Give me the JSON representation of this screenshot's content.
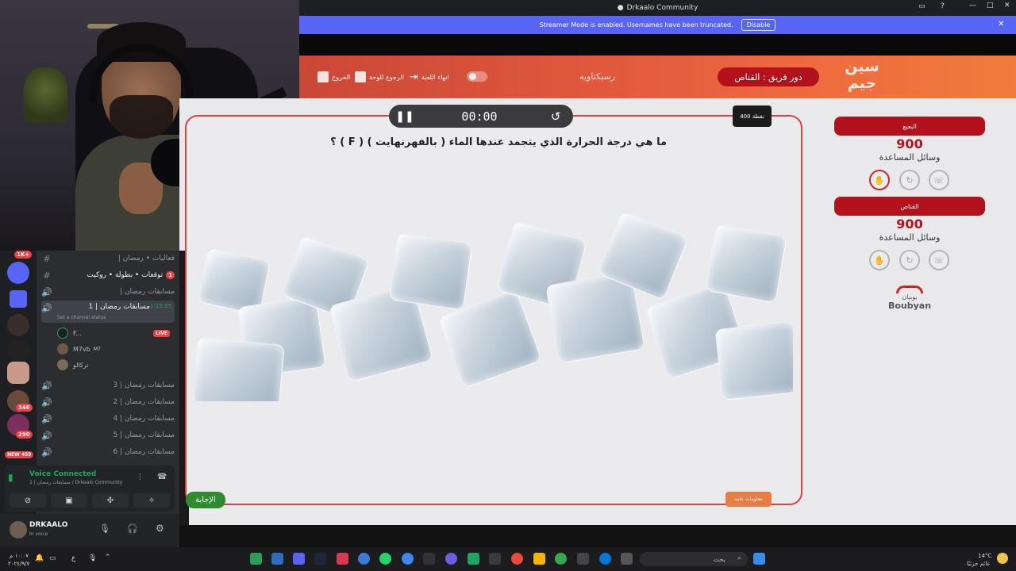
{
  "window": {
    "title": "Drkaalo Community",
    "streamer_banner": "Streamer Mode is enabled. Usernames have been truncated.",
    "disable_label": "Disable"
  },
  "game": {
    "header": {
      "exit": "الخروج",
      "back_to_board": "الرجوع للوحة",
      "end_game": "انهاء اللعبة",
      "game_name": "رسبكتاويه",
      "turn": "دور فريق : القناص",
      "logo": "سين جيم"
    },
    "timer": "00:00",
    "points_badge": "400 نقطة",
    "question": "ما هي درجة الحرارة الذي يتجمد عندها الماء ( بالفهرنهايت ) ( F ) ؟",
    "answer_button": "الإجابة",
    "info_button": "معلومات عامة",
    "teams": [
      {
        "name": "البعبع",
        "score": "900",
        "aids_label": "وسائل المساعدة"
      },
      {
        "name": "القناص",
        "score": "900",
        "aids_label": "وسائل المساعدة"
      }
    ],
    "sponsor": {
      "arabic": "بوبيان",
      "english": "Boubyan"
    }
  },
  "discord": {
    "server_badges": [
      "1K+",
      "1",
      "346",
      "290",
      "NEW 459"
    ],
    "channels": [
      {
        "name": "فعاليات • رمضان |",
        "icon": "#"
      },
      {
        "name": "توقعات • بطولة • روكيت",
        "icon": "#",
        "badge": "1"
      },
      {
        "name": "مسابقات رمضان |",
        "icon": "voice"
      },
      {
        "name": "مسابقات رمضان | 1",
        "icon": "voice",
        "active": true,
        "time": "1:15:35",
        "status": "Set a channel status"
      }
    ],
    "voice_users": [
      {
        "name": "F...",
        "live": "LIVE"
      },
      {
        "name": "M7vb",
        "tag": "M7"
      },
      {
        "name": "تركالو"
      }
    ],
    "channels_after": [
      {
        "name": "مسابقات رمضان | 3"
      },
      {
        "name": "مسابقات رمضان | 2"
      },
      {
        "name": "مسابقات رمضان | 4"
      },
      {
        "name": "مسابقات رمضان | 5"
      },
      {
        "name": "مسابقات رمضان | 6"
      }
    ],
    "voice_connected": "Voice Connected",
    "voice_sub": "1 | مسابقات رمضان / Drkaalo Community",
    "user": {
      "name": "DRKAALO",
      "status": "In voice"
    }
  },
  "taskbar": {
    "search_placeholder": "بحث",
    "time": "١٠:٠٧ م",
    "date": "٢٠٢٤/٩/٧",
    "weather": "14°C",
    "weather_sub": "غائم جزئيًا",
    "lang": "ع"
  }
}
